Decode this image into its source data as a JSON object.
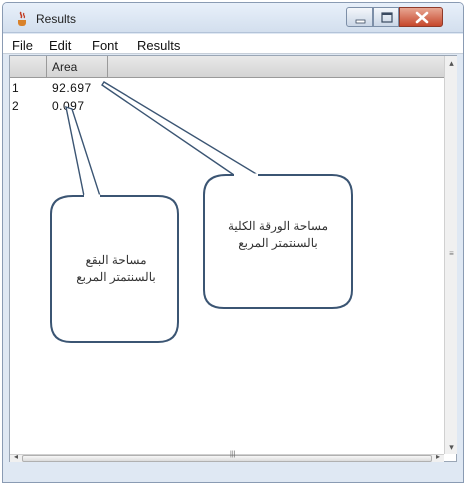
{
  "window": {
    "title": "Results"
  },
  "menu": {
    "items": [
      "File",
      "Edit",
      "Font",
      "Results"
    ]
  },
  "table": {
    "columns": [
      "",
      "Area"
    ],
    "rows": [
      {
        "index": "1",
        "area": "92.697"
      },
      {
        "index": "2",
        "area": "0.097"
      }
    ]
  },
  "callouts": {
    "left": {
      "line1": "مساحة البقع",
      "line2": "بالسنتمتر المربع"
    },
    "right": {
      "line1": "مساحة الورقة الكلية",
      "line2": "بالسنتمتر المربع"
    }
  },
  "colors": {
    "titlebar": "#d3dfee",
    "close_button": "#c6472c",
    "callout_border": "#3b5573"
  },
  "icons": {
    "app": "java-cup-icon",
    "minimize": "minimize-icon",
    "maximize": "maximize-icon",
    "close": "close-icon"
  }
}
